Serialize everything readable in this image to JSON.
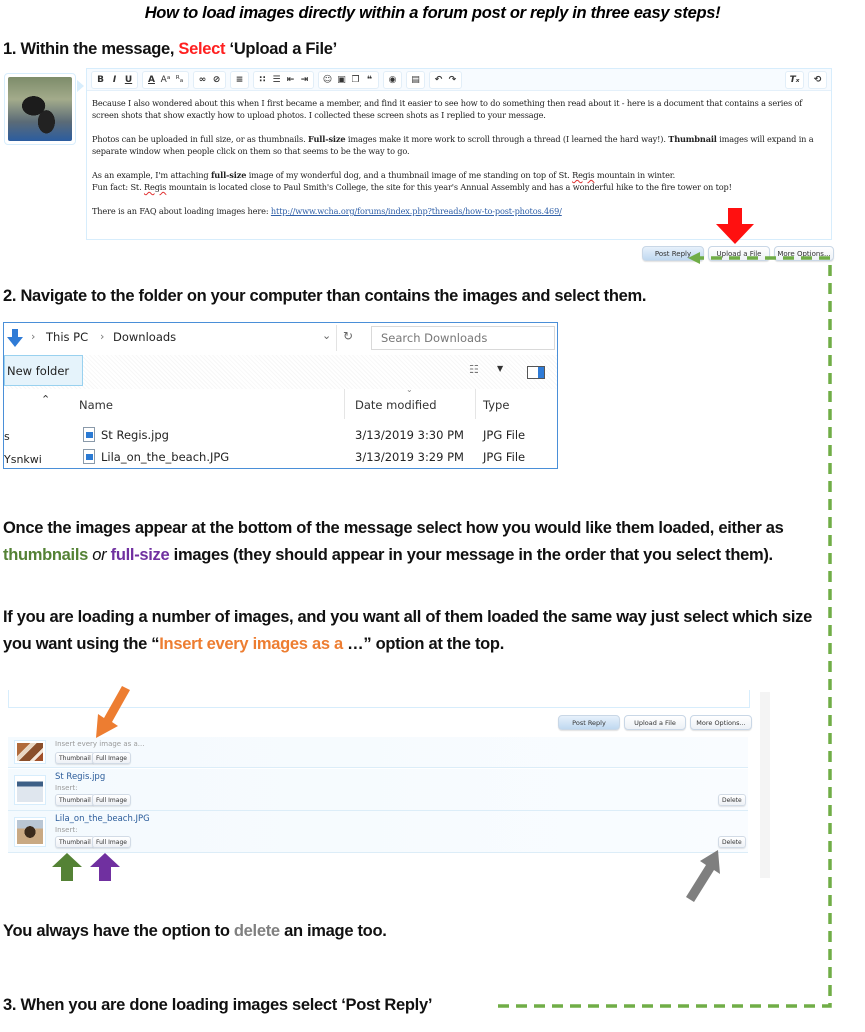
{
  "title": "How to load images directly within a forum post or reply in three easy steps!",
  "step1": {
    "prefix": "1.  Within the message, ",
    "highlight": "Select",
    "suffix": " ‘Upload a File’"
  },
  "editor": {
    "toolbar_icons": [
      "bold-icon",
      "italic-icon",
      "underline-icon",
      "font-color-icon",
      "font-size-icon",
      "font-family-icon",
      "link-icon",
      "unlink-icon",
      "align-icon",
      "bullet-list-icon",
      "numbered-list-icon",
      "outdent-icon",
      "indent-icon",
      "smiley-icon",
      "image-icon",
      "media-icon",
      "quote-icon",
      "camera-icon",
      "save-draft-icon",
      "undo-icon",
      "redo-icon"
    ],
    "toolbar_glyphs": [
      "B",
      "I",
      "U",
      "A",
      "Aᵃ",
      "ᴿₐ",
      "∞",
      "⊘",
      "≡",
      "∷",
      "☰",
      "⇤",
      "⇥",
      "☺",
      "▣",
      "❐",
      "❝",
      "◉",
      "▤",
      "↶",
      "↷"
    ],
    "right_icons": [
      "remove-format-icon",
      "toggle-bbcode-icon"
    ],
    "right_glyphs": [
      "Tₓ",
      "⟲"
    ],
    "p1": "Because I also wondered about this when I first became a member, and find it easier to see how to do something then read about it  -  here is a document that contains a series of screen shots that show exactly how to upload photos. I collected these screen shots as I replied to your message.",
    "p2_a": "Photos can be uploaded in full size, or as thumbnails. ",
    "p2_b1": "Full-size",
    "p2_c": " images make it more work to scroll through a thread (I learned the hard way!). ",
    "p2_b2": "Thumbnail",
    "p2_d": " images will expand in a separate window when people click on them so that seems to be the way to go.",
    "p3_a": "As an example, I'm attaching ",
    "p3_b": "full-size",
    "p3_c": " image of my wonderful dog, and a thumbnail image of me standing on top of St. ",
    "p3_regis": "Regis",
    "p3_d": " mountain in winter.",
    "p3_line2_a": "Fun fact: St. ",
    "p3_line2_regis": "Regis",
    "p3_line2_b": " mountain is located close to Paul Smith's College, the site for this year's Annual Assembly and has a wonderful hike to the fire tower on top!",
    "p4_a": "There is an FAQ about loading images here: ",
    "p4_link": "http://www.wcha.org/forums/index.php?threads/how-to-post-photos.469/"
  },
  "actions": {
    "post_reply": "Post Reply",
    "upload_file": "Upload a File",
    "more_options": "More Options..."
  },
  "step2": "2.  Navigate to the folder on your computer than contains the images and select them.",
  "explorer": {
    "breadcrumb": [
      "This PC",
      "Downloads"
    ],
    "search_placeholder": "Search Downloads",
    "new_folder": "New folder",
    "columns": [
      "Name",
      "Date modified",
      "Type"
    ],
    "sidebar_fragments": [
      "s",
      "Ysnkwi"
    ],
    "files": [
      {
        "name": "St Regis.jpg",
        "date": "3/13/2019 3:30 PM",
        "type": "JPG File"
      },
      {
        "name": "Lila_on_the_beach.JPG",
        "date": "3/13/2019 3:29 PM",
        "type": "JPG File"
      }
    ]
  },
  "para_once": {
    "a": "Once the images appear at the bottom of the message select how you would like them loaded, either as ",
    "thumbnails": "thumbnails",
    "or": " or ",
    "fullsize": "full-size",
    "b": " images (they should appear in your message in the order that you select them)."
  },
  "para_if": {
    "a": "If you are loading a number of images, and you want all of them loaded the same way just select which size you want using the  “",
    "highlight": "Insert every images as a ",
    "b": "…” option at the top."
  },
  "attachments": {
    "actions": {
      "post_reply": "Post Reply",
      "upload_file": "Upload a File",
      "more_options": "More Options..."
    },
    "insert_every": "Insert every image as a...",
    "insert_label": "Insert:",
    "thumbnail": "Thumbnail",
    "full_image": "Full Image",
    "delete": "Delete",
    "items": [
      {
        "name": "St Regis.jpg"
      },
      {
        "name": "Lila_on_the_beach.JPG"
      }
    ]
  },
  "para_delete": {
    "a": "You always have the option to ",
    "highlight": "delete",
    "b": " an image too."
  },
  "step3": "3.  When you are done loading images select ‘Post Reply’",
  "colors": {
    "red": "#ff2020",
    "green": "#548235",
    "purple": "#7030a0",
    "orange": "#ed7d31",
    "grey": "#808080",
    "dash_green": "#70ad47"
  }
}
